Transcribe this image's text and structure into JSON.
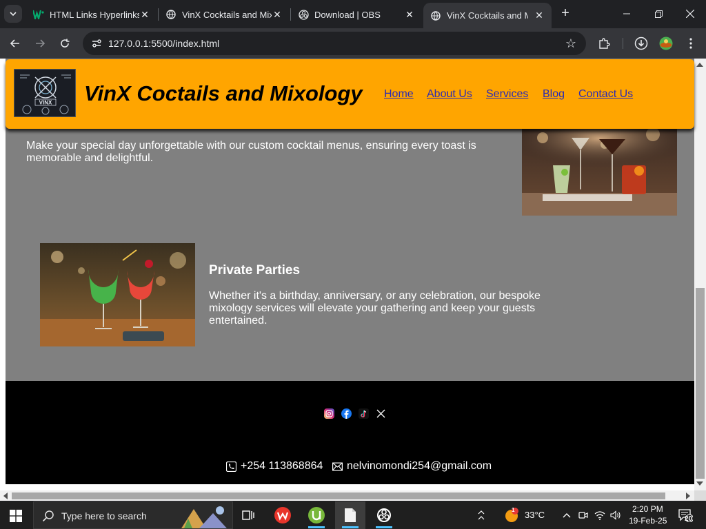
{
  "browser": {
    "tabs": [
      {
        "title": "HTML Links Hyperlinks",
        "favicon": "w3schools-icon",
        "active": false
      },
      {
        "title": "VinX Cocktails and Mix",
        "favicon": "globe-icon",
        "active": false
      },
      {
        "title": "Download | OBS",
        "favicon": "obs-icon",
        "active": false
      },
      {
        "title": "VinX Cocktails and Mix",
        "favicon": "globe-icon",
        "active": true
      }
    ],
    "url": "127.0.0.1:5500/index.html"
  },
  "site": {
    "logo_text": "VINX",
    "title": "VinX Coctails and Mixology",
    "nav": [
      "Home",
      "About Us",
      "Services",
      "Blog",
      "Contact Us"
    ],
    "services": [
      {
        "heading": "",
        "text": "Make your special day unforgettable with our custom cocktail menus, ensuring every toast is memorable and delightful."
      },
      {
        "heading": "Private Parties",
        "text": "Whether it's a birthday, anniversary, or any celebration, our bespoke mixology services will elevate your gathering and keep your guests entertained."
      }
    ],
    "footer": {
      "social": [
        "instagram-icon",
        "facebook-icon",
        "tiktok-icon",
        "x-icon"
      ],
      "phone": "+254 113868864",
      "email": "nelvinomondi254@gmail.com"
    }
  },
  "taskbar": {
    "search_placeholder": "Type here to search",
    "weather": "33°C",
    "weather_badge": "1",
    "time": "2:20 PM",
    "date": "19-Feb-25",
    "notifications": "20"
  },
  "colors": {
    "header_bg": "#ffa500",
    "page_bg": "#808080",
    "footer_bg": "#000000",
    "nav_link": "#2b2bb5"
  }
}
